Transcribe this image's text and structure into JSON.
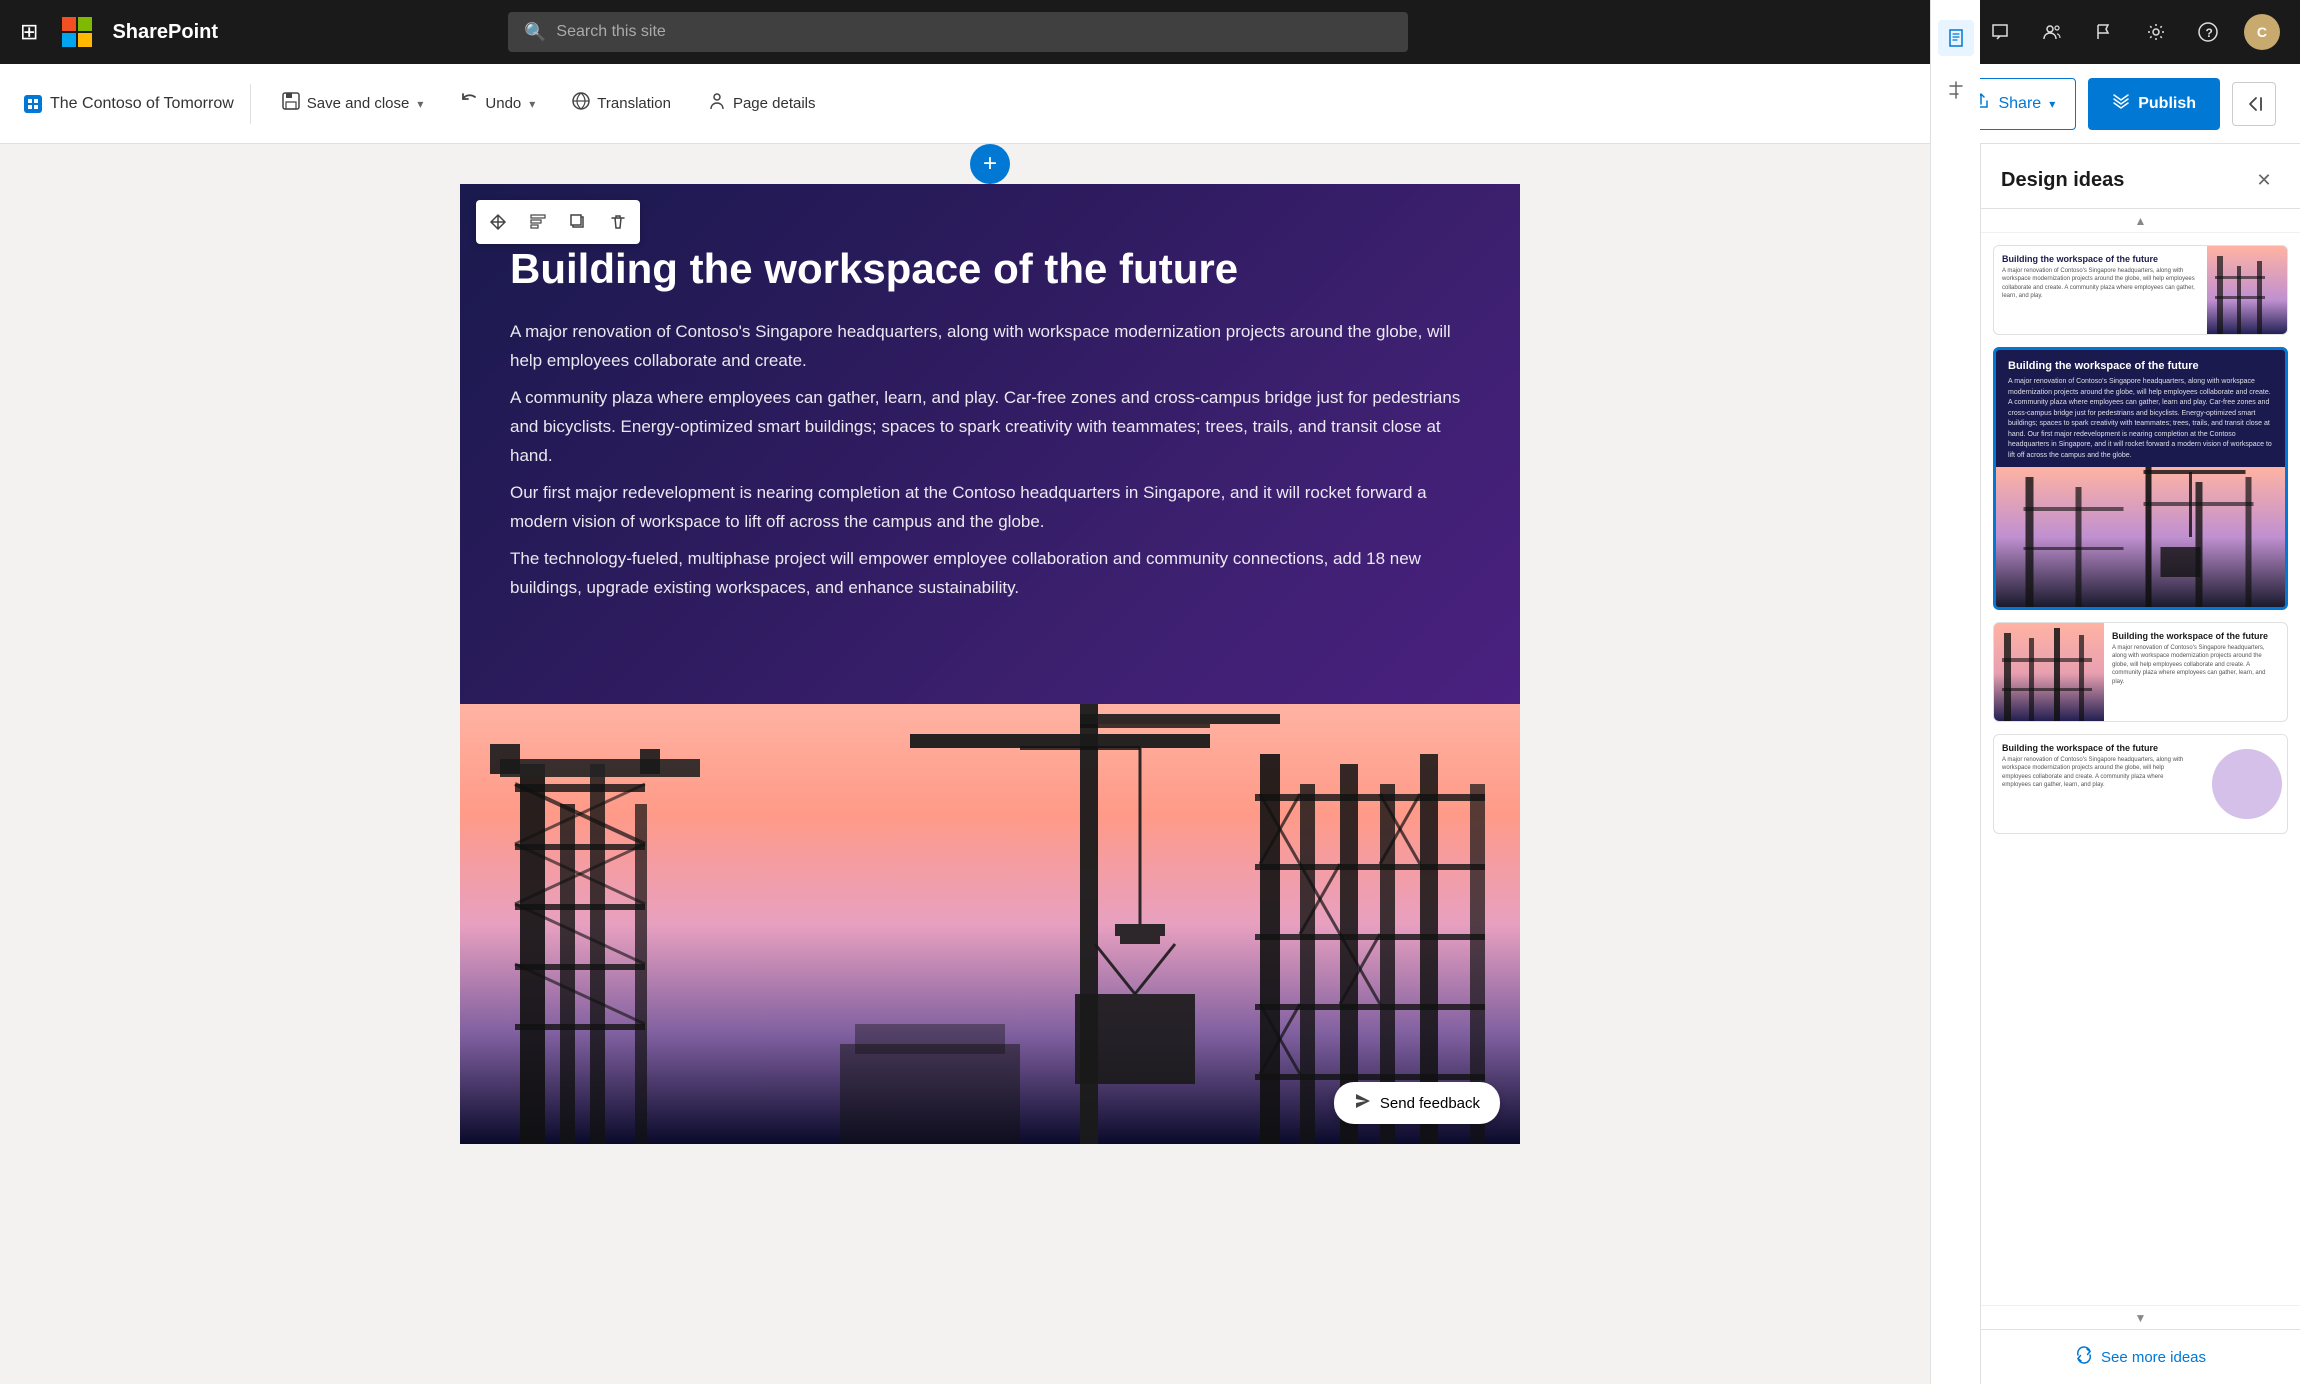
{
  "topnav": {
    "app_name": "SharePoint",
    "search_placeholder": "Search this site"
  },
  "toolbar": {
    "page_name": "The Contoso of Tomorrow",
    "save_close_label": "Save and close",
    "undo_label": "Undo",
    "translation_label": "Translation",
    "page_details_label": "Page details",
    "share_label": "Share",
    "publish_label": "Publish"
  },
  "hero": {
    "title": "Building the workspace of the future",
    "body_lines": [
      "A major renovation of Contoso's Singapore headquarters, along with workspace modernization projects around the globe, will help employees collaborate and create.",
      "A community plaza where employees can gather, learn, and play. Car-free zones and cross-campus bridge just for pedestrians and bicyclists. Energy-optimized smart buildings; spaces to spark creativity with teammates; trees, trails, and transit close at hand.",
      "Our first major redevelopment is nearing completion at the Contoso headquarters in Singapore, and it will rocket forward a modern vision of workspace to lift off across the campus and the globe.",
      "The technology-fueled, multiphase project will empower employee collaboration and community connections, add 18 new buildings, upgrade existing workspaces, and enhance sustainability."
    ]
  },
  "image_section": {
    "label": "Image"
  },
  "send_feedback": {
    "label": "Send feedback"
  },
  "design_panel": {
    "title": "Design ideas",
    "see_more_label": "See more ideas",
    "ideas": [
      {
        "id": "card1",
        "title": "Building the workspace of the future",
        "selected": false
      },
      {
        "id": "card2",
        "title": "Building the workspace of the future",
        "selected": true
      },
      {
        "id": "card3",
        "title": "Building the workspace of the future",
        "selected": false
      },
      {
        "id": "card4",
        "title": "Building the workspace of the future",
        "selected": false
      }
    ]
  }
}
